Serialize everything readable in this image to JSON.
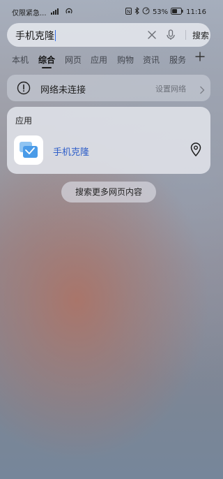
{
  "status_bar": {
    "carrier_text": "仅限紧急...",
    "battery_percent": "53%",
    "time": "11:16"
  },
  "search": {
    "query": "手机克隆",
    "button_label": "搜索"
  },
  "tabs": [
    {
      "label": "本机"
    },
    {
      "label": "综合"
    },
    {
      "label": "网页"
    },
    {
      "label": "应用"
    },
    {
      "label": "购物"
    },
    {
      "label": "资讯"
    },
    {
      "label": "服务"
    }
  ],
  "network_notice": {
    "message": "网络未连接",
    "settings_label": "设置网络"
  },
  "app_section": {
    "title": "应用",
    "app_name": "手机克隆"
  },
  "more_button_label": "搜索更多网页内容"
}
